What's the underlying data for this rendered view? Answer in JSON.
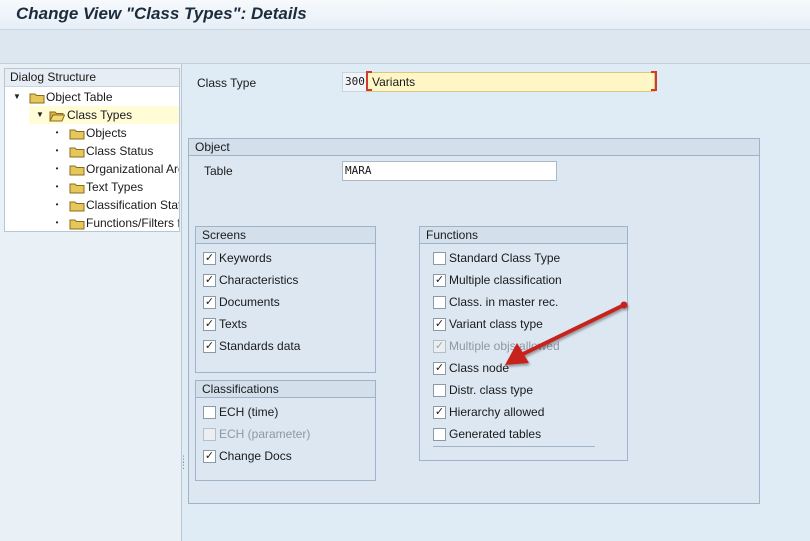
{
  "window": {
    "title": "Change View \"Class Types\": Details"
  },
  "tree": {
    "header": "Dialog Structure",
    "items": [
      {
        "label": "Object Table",
        "ctrl": "▼"
      },
      {
        "label": "Class Types",
        "ctrl": "▼",
        "selected": true
      },
      {
        "label": "Objects",
        "ctrl": "•"
      },
      {
        "label": "Class Status",
        "ctrl": "•"
      },
      {
        "label": "Organizational Areas",
        "ctrl": "•"
      },
      {
        "label": "Text Types",
        "ctrl": "•"
      },
      {
        "label": "Classification Status",
        "ctrl": "•"
      },
      {
        "label": "Functions/Filters for Class Type",
        "ctrl": "•"
      }
    ]
  },
  "class_type": {
    "label": "Class Type",
    "number": "300",
    "name": "Variants"
  },
  "object_group": {
    "title": "Object",
    "table_label": "Table",
    "table_value": "MARA"
  },
  "screens_group": {
    "title": "Screens",
    "items": [
      {
        "label": "Keywords",
        "checked": true,
        "disabled": false
      },
      {
        "label": "Characteristics",
        "checked": true,
        "disabled": false
      },
      {
        "label": "Documents",
        "checked": true,
        "disabled": false
      },
      {
        "label": "Texts",
        "checked": true,
        "disabled": false
      },
      {
        "label": "Standards data",
        "checked": true,
        "disabled": false
      }
    ]
  },
  "classifications_group": {
    "title": "Classifications",
    "items": [
      {
        "label": "ECH (time)",
        "checked": false,
        "disabled": false
      },
      {
        "label": "ECH (parameter)",
        "checked": false,
        "disabled": true
      },
      {
        "label": "Change Docs",
        "checked": true,
        "disabled": false
      }
    ]
  },
  "functions_group": {
    "title": "Functions",
    "items": [
      {
        "label": "Standard Class Type",
        "checked": false,
        "disabled": false
      },
      {
        "label": "Multiple classification",
        "checked": true,
        "disabled": false
      },
      {
        "label": "Class. in master rec.",
        "checked": false,
        "disabled": false
      },
      {
        "label": "Variant class type",
        "checked": true,
        "disabled": false
      },
      {
        "label": "Multiple objs allowed",
        "checked": true,
        "disabled": true
      },
      {
        "label": "Class node",
        "checked": true,
        "disabled": false
      },
      {
        "label": "Distr. class type",
        "checked": false,
        "disabled": false
      },
      {
        "label": "Hierarchy allowed",
        "checked": true,
        "disabled": false
      },
      {
        "label": "Generated tables",
        "checked": false,
        "disabled": false
      }
    ]
  },
  "annotation": {
    "arrow_color": "#c8201e"
  },
  "colors": {
    "folder": "#e8c75a",
    "selection": "#fffcd6",
    "highlight_field": "#fff6c8"
  }
}
